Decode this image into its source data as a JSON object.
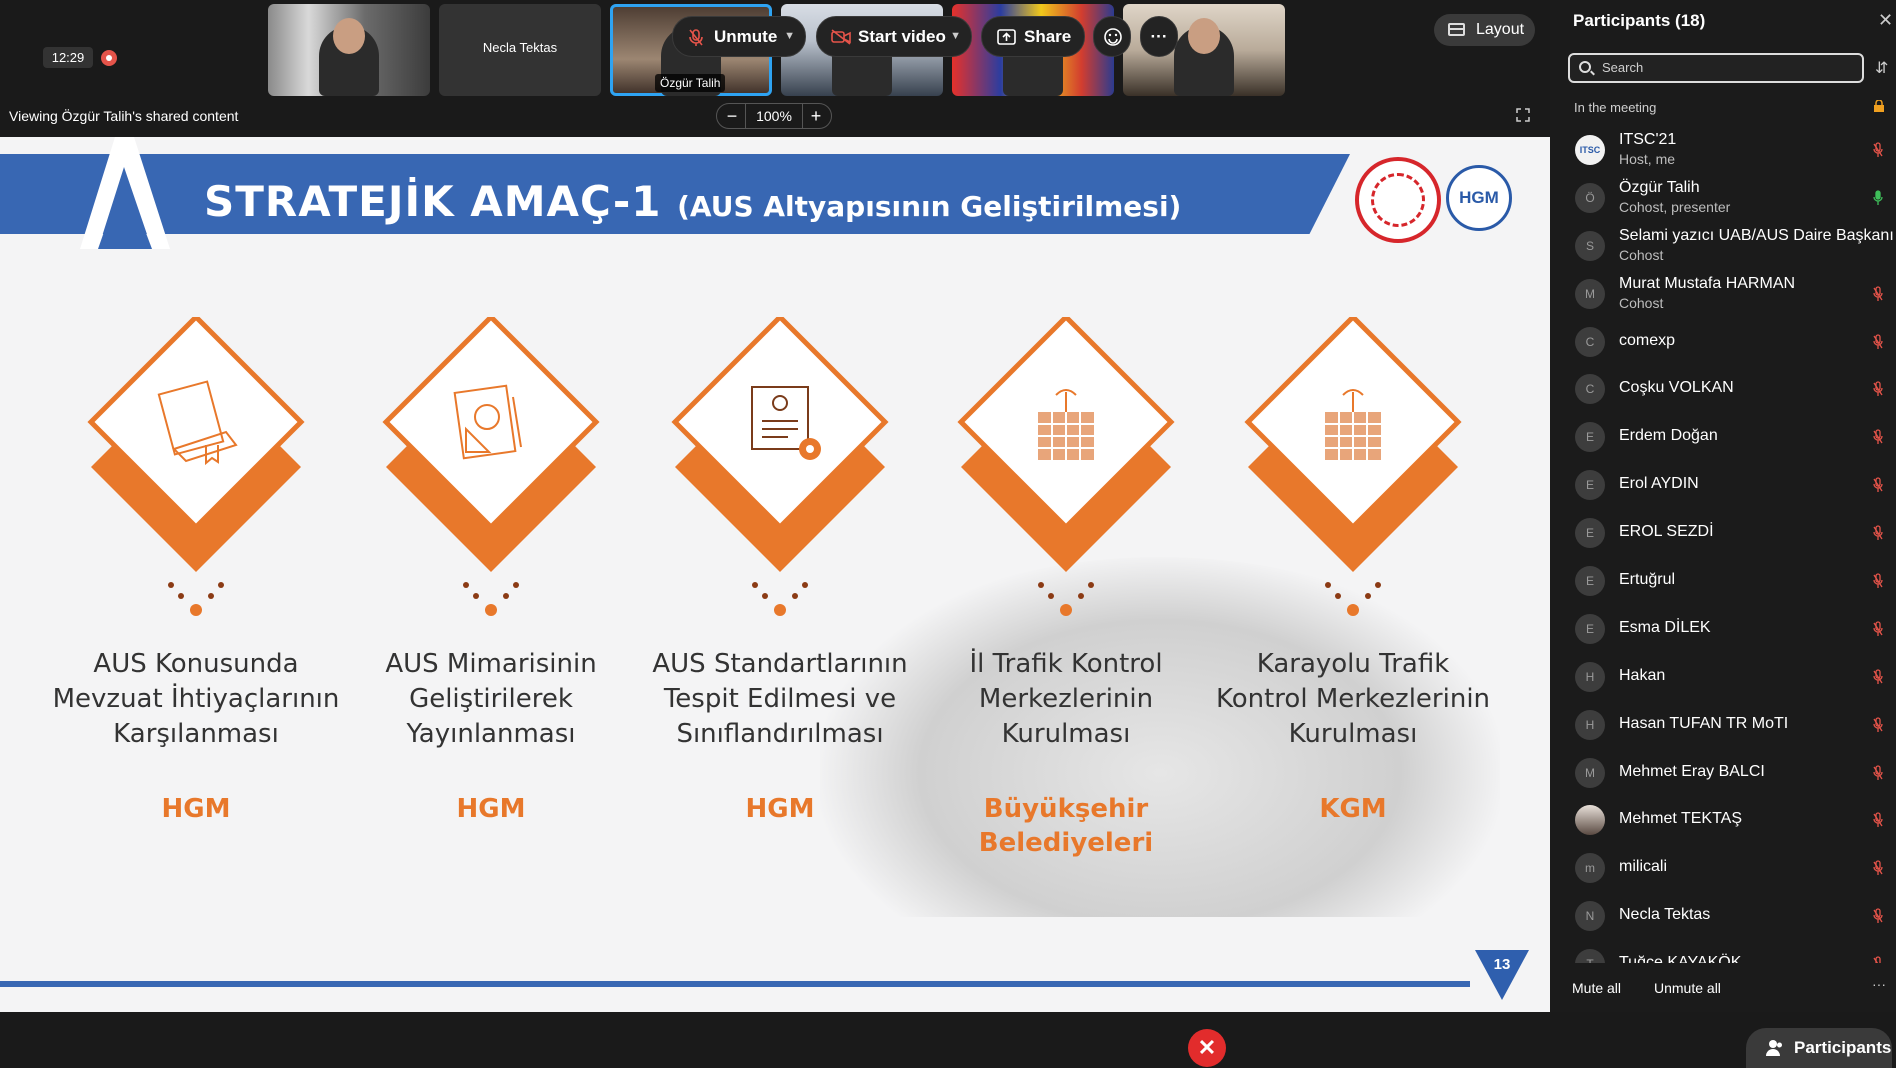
{
  "meeting": {
    "timer": "12:29",
    "viewing_text": "Viewing Özgür Talih's shared content",
    "zoom_level": "100%",
    "zoom_out": "−",
    "zoom_in": "+",
    "layout_label": "Layout"
  },
  "thumbnails": [
    {
      "label": ""
    },
    {
      "label": "Necla Tektas"
    },
    {
      "label": "Özgür Talih"
    },
    {
      "label": ""
    },
    {
      "label": ""
    },
    {
      "label": ""
    }
  ],
  "slide": {
    "title": "STRATEJİK AMAÇ-1",
    "subtitle": "(AUS Altyapısının Geliştirilmesi)",
    "logo2_text": "HGM",
    "page_number": "13",
    "items": [
      {
        "text": "AUS Konusunda Mevzuat İhtiyaçlarının Karşılanması",
        "org": "HGM",
        "icon": "book-icon"
      },
      {
        "text": "AUS Mimarisinin Geliştirilerek Yayınlanması",
        "org": "HGM",
        "icon": "blueprint-icon"
      },
      {
        "text": "AUS Standartlarının Tespit Edilmesi ve Sınıflandırılması",
        "org": "HGM",
        "icon": "certificate-icon"
      },
      {
        "text": "İl Trafik Kontrol Merkezlerinin Kurulması",
        "org": "Büyükşehir Belediyeleri",
        "icon": "building-icon"
      },
      {
        "text": "Karayolu Trafik Kontrol Merkezlerinin Kurulması",
        "org": "KGM",
        "icon": "building-icon"
      }
    ]
  },
  "participants": {
    "title": "Participants (18)",
    "search_placeholder": "Search",
    "section": "In the meeting",
    "mute_all": "Mute all",
    "unmute_all": "Unmute all",
    "more": "···",
    "list": [
      {
        "initial": "ITSC",
        "name": "ITSC'21",
        "role": "Host, me",
        "mic": "muted"
      },
      {
        "initial": "Ö",
        "name": "Özgür Talih",
        "role": "Cohost, presenter",
        "mic": "active"
      },
      {
        "initial": "S",
        "name": "Selami yazıcı UAB/AUS Daire Başkanı",
        "role": "Cohost",
        "mic": "none"
      },
      {
        "initial": "M",
        "name": "Murat Mustafa HARMAN",
        "role": "Cohost",
        "mic": "muted"
      },
      {
        "initial": "C",
        "name": "comexp",
        "role": "",
        "mic": "muted"
      },
      {
        "initial": "C",
        "name": "Coşku VOLKAN",
        "role": "",
        "mic": "muted"
      },
      {
        "initial": "E",
        "name": "Erdem Doğan",
        "role": "",
        "mic": "muted"
      },
      {
        "initial": "E",
        "name": "Erol AYDIN",
        "role": "",
        "mic": "muted"
      },
      {
        "initial": "E",
        "name": "EROL SEZDİ",
        "role": "",
        "mic": "muted"
      },
      {
        "initial": "E",
        "name": "Ertuğrul",
        "role": "",
        "mic": "muted"
      },
      {
        "initial": "E",
        "name": "Esma DİLEK",
        "role": "",
        "mic": "muted"
      },
      {
        "initial": "H",
        "name": "Hakan",
        "role": "",
        "mic": "muted"
      },
      {
        "initial": "H",
        "name": "Hasan TUFAN TR MoTI",
        "role": "",
        "mic": "muted"
      },
      {
        "initial": "M",
        "name": "Mehmet Eray BALCI",
        "role": "",
        "mic": "muted"
      },
      {
        "initial": "",
        "name": "Mehmet TEKTAŞ",
        "role": "",
        "mic": "muted"
      },
      {
        "initial": "m",
        "name": "milicali",
        "role": "",
        "mic": "muted"
      },
      {
        "initial": "N",
        "name": "Necla Tektas",
        "role": "",
        "mic": "muted"
      },
      {
        "initial": "T",
        "name": "Tuğçe KAYAKÖK",
        "role": "",
        "mic": "muted"
      }
    ]
  },
  "toolbar": {
    "unmute": "Unmute",
    "start_video": "Start video",
    "share": "Share",
    "more": "···",
    "end": "✕",
    "participants": "Participants"
  },
  "colors": {
    "accent_blue": "#3867b3",
    "orange": "#e8782b",
    "end_red": "#e22c2c",
    "mute_red": "#e5544a",
    "active_green": "#3fbf5a",
    "highlight": "#2ea3f2"
  }
}
